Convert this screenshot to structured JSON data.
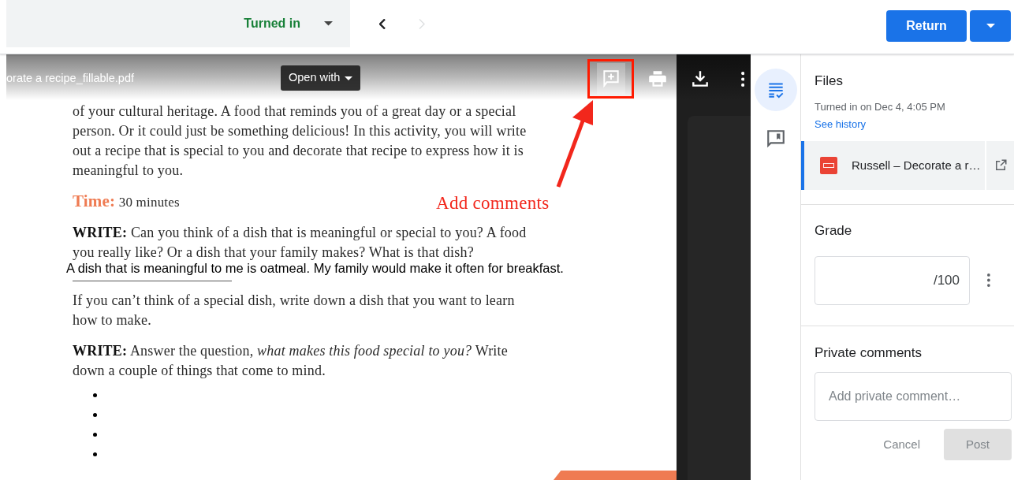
{
  "top_bar": {
    "status": {
      "label": "Turned in"
    },
    "nav": [
      {
        "kind": "prev",
        "disabled": false
      },
      {
        "kind": "next",
        "disabled": true
      }
    ],
    "return_button": {
      "label": "Return"
    }
  },
  "viewer": {
    "file_name": "orate a recipe_fillable.pdf",
    "open_with": "Open with",
    "tools": [
      {
        "kind": "comment",
        "annotated": true
      },
      {
        "kind": "print",
        "annotated": false
      },
      {
        "kind": "download",
        "annotated": false
      },
      {
        "kind": "more",
        "annotated": false
      }
    ]
  },
  "document": {
    "blocks": [
      {
        "kind": "paragraph",
        "text": "of your cultural heritage. A food that reminds you of a great day or a special person. Or it could just be something delicious! In this activity, you will write out a recipe that is special to you and decorate that recipe to express how it is meaningful to you."
      },
      {
        "kind": "time",
        "text": "**Time:** 30 minutes"
      },
      {
        "kind": "paragraph",
        "text": "**WRITE:** Can you think of a dish that is meaningful or special to you? A food you really like? Or a dish that your family makes? What is that dish?"
      },
      {
        "kind": "answer",
        "text": "A dish that is meaningful to me is oatmeal. My family would make it often for breakfast."
      },
      {
        "kind": "paragraph",
        "text": "If you can’t think of a special dish, write down a dish that you want to learn how to make."
      },
      {
        "kind": "paragraph",
        "text": "**WRITE:** Answer the question, *what makes this food special to you?* Write down a couple of things that come to mind."
      }
    ]
  },
  "annotation": {
    "label": "Add comments"
  },
  "side_rail": [
    {
      "kind": "details",
      "selected": true
    },
    {
      "kind": "comments",
      "selected": false
    }
  ],
  "files": {
    "title": "Files",
    "turned_in": "Turned in on Dec 4, 4:05 PM",
    "history_link": "See history",
    "items": [
      {
        "name": "Russell – Decorate a r…",
        "selected": true
      }
    ]
  },
  "grade": {
    "title": "Grade",
    "suffix": "/100"
  },
  "private_comments": {
    "title": "Private comments",
    "placeholder": "Add private comment…",
    "cancel": "Cancel",
    "post": {
      "label": "Post",
      "disabled": true
    }
  }
}
